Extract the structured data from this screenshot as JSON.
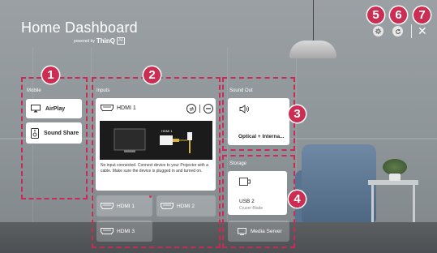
{
  "header": {
    "title": "Home Dashboard",
    "powered_by": "powered by",
    "brand": "ThinQ",
    "brand_ai": "AI",
    "close_glyph": "✕"
  },
  "badges": [
    "1",
    "2",
    "3",
    "4",
    "5",
    "6",
    "7"
  ],
  "mobile": {
    "label": "Mobile",
    "items": [
      {
        "label": "AirPlay",
        "icon": "airplay-icon"
      },
      {
        "label": "Sound Share",
        "icon": "sound-share-icon"
      }
    ]
  },
  "inputs": {
    "label": "Inputs",
    "selected": {
      "name": "HDMI 1",
      "message": "No input connected. Connect device to your Projector with a cable. Make sure the device is plugged in and turned on.",
      "illustration_label": "HDMI 1"
    },
    "tiles": [
      {
        "label": "HDMI 1",
        "has_dot": true
      },
      {
        "label": "HDMI 2",
        "has_dot": false
      },
      {
        "label": "HDMI 3",
        "has_dot": false
      }
    ]
  },
  "sound_out": {
    "label": "Sound Out",
    "current": "Optical + Interna..."
  },
  "storage": {
    "label": "Storage",
    "device": {
      "name": "USB 2",
      "sub": "Cruzer Blade"
    },
    "media_server": "Media Server"
  },
  "colors": {
    "accent": "#cc2d52",
    "frame": "#c92a56",
    "card": "#ffffff"
  }
}
